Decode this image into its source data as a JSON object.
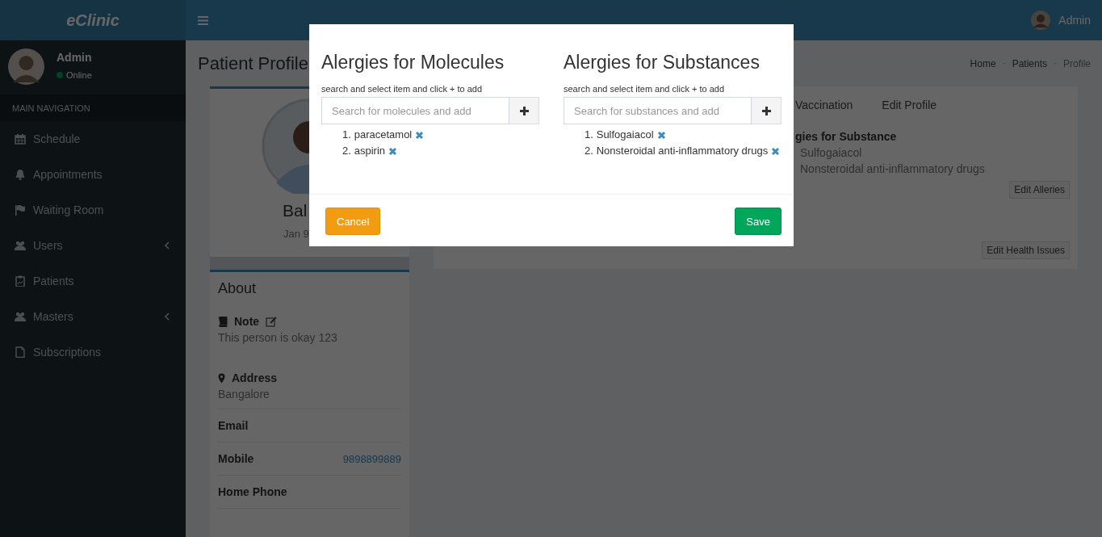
{
  "header": {
    "logo": "eClinic",
    "user": "Admin"
  },
  "sidebar": {
    "user": {
      "name": "Admin",
      "status": "Online"
    },
    "section": "MAIN NAVIGATION",
    "items": [
      {
        "label": "Schedule",
        "expandable": false
      },
      {
        "label": "Appointments",
        "expandable": false
      },
      {
        "label": "Waiting Room",
        "expandable": false
      },
      {
        "label": "Users",
        "expandable": true
      },
      {
        "label": "Patients",
        "expandable": false
      },
      {
        "label": "Masters",
        "expandable": true
      },
      {
        "label": "Subscriptions",
        "expandable": false
      }
    ]
  },
  "page": {
    "title": "Patient Profile",
    "breadcrumb": [
      "Home",
      "Patients",
      "Profile"
    ]
  },
  "profile_card": {
    "name": "Bal",
    "date": "Jan 9"
  },
  "about": {
    "title": "About",
    "note_label": "Note",
    "note": "This person is okay 123",
    "fields": [
      {
        "kind": "stacked",
        "label": "Address",
        "value": "Bangalore"
      },
      {
        "kind": "row",
        "label": "Email"
      },
      {
        "kind": "row",
        "label": "Mobile",
        "value": "9898899889"
      },
      {
        "kind": "row",
        "label": "Home Phone"
      }
    ]
  },
  "details": {
    "tabs": [
      {
        "label": "Vaccination",
        "selected": false
      },
      {
        "label": "Edit Profile",
        "selected": false
      }
    ],
    "allergy_heading": "gies for Substance",
    "allergy_items": [
      "Sulfogaiacol",
      "Nonsteroidal anti-inflammatory drugs"
    ],
    "buttons": [
      "Edit Alleries",
      "Edit Health Issues"
    ]
  },
  "modal": {
    "sections": [
      {
        "title": "Alergies for Molecules",
        "hint": "search and select item and click + to add",
        "placeholder": "Search for molecules and add",
        "items": [
          {
            "number": "1.",
            "name": "paracetamol"
          },
          {
            "number": "2.",
            "name": "aspirin"
          }
        ]
      },
      {
        "title": "Alergies for Substances",
        "hint": "search and select item and click + to add",
        "placeholder": "Search for substances and add",
        "items": [
          {
            "number": "1.",
            "name": "Sulfogaiacol"
          },
          {
            "number": "2.",
            "name": "Nonsteroidal anti-inflammatory drugs"
          }
        ]
      }
    ],
    "buttons": [
      {
        "kind": "cancel",
        "label": "Cancel"
      },
      {
        "kind": "save",
        "label": "Save"
      }
    ]
  }
}
